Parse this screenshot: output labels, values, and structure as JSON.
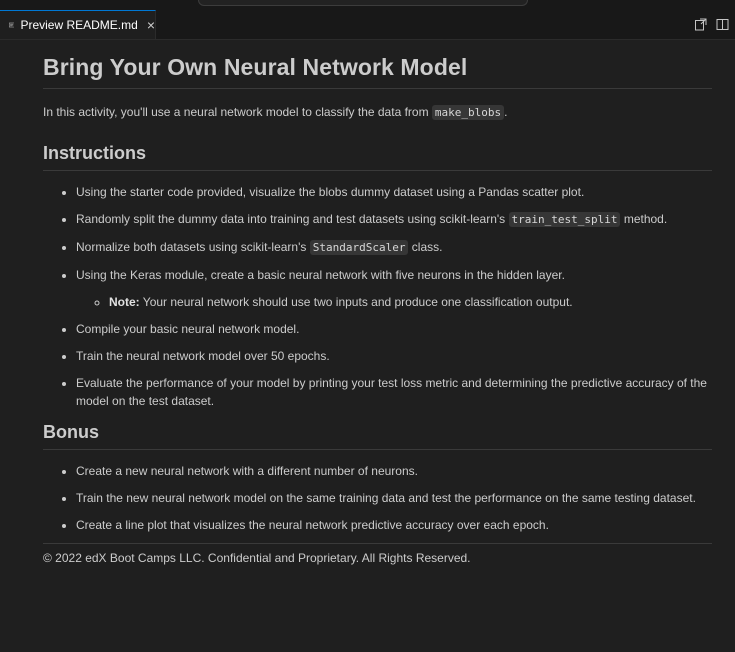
{
  "tab": {
    "title": "Preview README.md",
    "close": "×"
  },
  "doc": {
    "title": "Bring Your Own Neural Network Model",
    "intro_before": "In this activity, you'll use a neural network model to classify the data from ",
    "intro_code": "make_blobs",
    "intro_after": ".",
    "instructions_heading": "Instructions",
    "instructions": {
      "i1": "Using the starter code provided, visualize the blobs dummy dataset using a Pandas scatter plot.",
      "i2_before": "Randomly split the dummy data into training and test datasets using scikit-learn's ",
      "i2_code": "train_test_split",
      "i2_after": " method.",
      "i3_before": "Normalize both datasets using scikit-learn's ",
      "i3_code": "StandardScaler",
      "i3_after": " class.",
      "i4": "Using the Keras module, create a basic neural network with five neurons in the hidden layer.",
      "i4_note_label": "Note:",
      "i4_note_text": " Your neural network should use two inputs and produce one classification output.",
      "i5": "Compile your basic neural network model.",
      "i6": "Train the neural network model over 50 epochs.",
      "i7": "Evaluate the performance of your model by printing your test loss metric and determining the predictive accuracy of the model on the test dataset."
    },
    "bonus_heading": "Bonus",
    "bonus": [
      "Create a new neural network with a different number of neurons.",
      "Train the new neural network model on the same training data and test the performance on the same testing dataset.",
      "Create a line plot that visualizes the neural network predictive accuracy over each epoch."
    ],
    "footer": "© 2022 edX Boot Camps LLC. Confidential and Proprietary. All Rights Reserved."
  }
}
